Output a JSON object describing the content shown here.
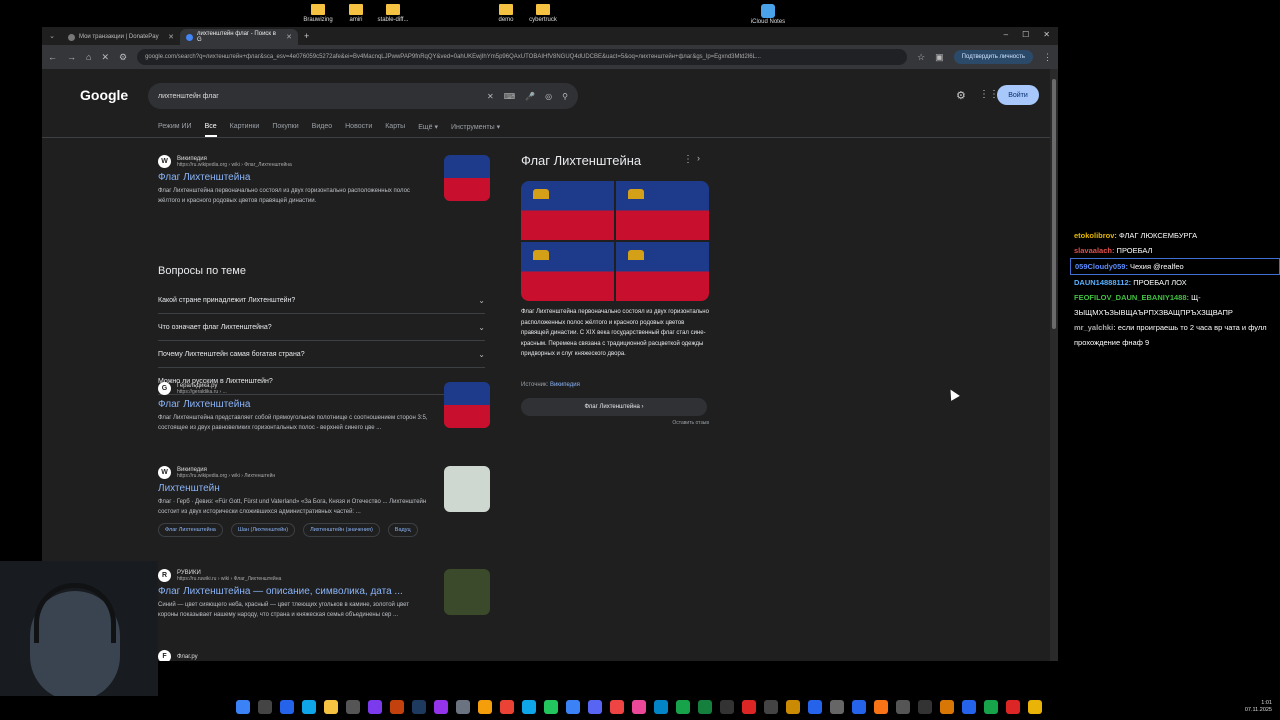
{
  "desktop": {
    "icons": [
      {
        "label": "Brauwizing"
      },
      {
        "label": "amiri"
      },
      {
        "label": "stable-diff..."
      },
      {
        "label": "demo"
      },
      {
        "label": "cybertruck"
      },
      {
        "label": "iCloud Notes"
      }
    ]
  },
  "browser": {
    "tabs": [
      {
        "label": "Мои транзакции | DonatePay"
      },
      {
        "label": "лихтенштейн флаг - Поиск в G"
      }
    ],
    "new_tab": "+",
    "url": "google.com/search?q=лихтенштейн+флаг&sca_esv=4e076059c5272afe&ei=Bv4MacnqLJPwwPAP9fnRqQY&ved=0ahUKEwjIhYm5p96QAxUTOBAIHfV8NGUQ4dUDCBE&uact=5&oq=лихтенштейн+флаг&gs_lp=Egxnd3Mtd2l6L...",
    "verify_label": "Подтвердить личность"
  },
  "google": {
    "logo": "Google",
    "query": "лихтенштейн флаг",
    "login_label": "Войти",
    "filters": [
      "Режим ИИ",
      "Все",
      "Картинки",
      "Покупки",
      "Видео",
      "Новости",
      "Карты",
      "Ещё",
      "Инструменты"
    ],
    "active_filter": "Все"
  },
  "results": [
    {
      "site": "Википедия",
      "url": "https://ru.wikipedia.org › wiki › Флаг_Лихтенштейна",
      "title": "Флаг Лихтенштейна",
      "snippet": "Флаг Лихтенштейна первоначально состоял из двух горизонтально расположенных полос жёлтого и красного родовых цветов правящей династии."
    },
    {
      "site": "Геральдика.ру",
      "url": "https://geraldika.ru › ...",
      "title": "Флаг Лихтенштейна",
      "snippet": "Флаг Лихтенштейна представляет собой прямоугольное полотнище с соотношением сторон 3:5, состоящее из двух равновеликих горизонтальных полос - верхней синего цве ..."
    },
    {
      "site": "Википедия",
      "url": "https://ru.wikipedia.org › wiki › Лихтенштейн",
      "title": "Лихтенштейн",
      "snippet": "Флаг · Герб · Девиз: «Für Gott, Fürst und Vaterland» «За Бога, Князя и Отечество ... Лихтенштейн состоит из двух исторически сложившихся административных частей: ...",
      "chips": [
        "Флаг Лихтенштейна",
        "Шан (Лихтенштейн)",
        "Лихтенштейн (значения)",
        "Вадуц"
      ]
    },
    {
      "site": "РУВИКИ",
      "url": "https://ru.ruwiki.ru › wiki › Флаг_Лихтенштейна",
      "title": "Флаг Лихтенштейна — описание, символика, дата ...",
      "snippet": "Синий — цвет сияющего неба, красный — цвет тлеющих угольков в камине, золотой цвет короны показывает нашему народу, что страна и княжеская семья объединены сер ..."
    },
    {
      "site": "Флаг.ру"
    }
  ],
  "paa": {
    "title": "Вопросы по теме",
    "items": [
      "Какой стране принадлежит Лихтенштейн?",
      "Что означает флаг Лихтенштейна?",
      "Почему Лихтенштейн самая богатая страна?",
      "Можно ли русским в Лихтенштейн?"
    ],
    "feedback": "Оставить отзыв"
  },
  "knowledge_panel": {
    "title": "Флаг Лихтенштейна",
    "description": "Флаг Лихтенштейна первоначально состоял из двух горизонтально расположенных полос жёлтого и красного родовых цветов правящей династии. С XIX века государственный флаг стал сине-красным. Перемена связана с традиционной расцветкой одежды придворных и слуг княжеского двора.",
    "source_label": "Источник:",
    "source_link": "Википедия",
    "button_label": "Флаг Лихтенштейна",
    "feedback": "Оставить отзыв"
  },
  "chat": [
    {
      "user": "etokolibrov:",
      "text": "ФЛАГ ЛЮКСЕМБУРГА",
      "color": "#e6b800"
    },
    {
      "user": "slavaalach:",
      "text": "ПРОЕБАЛ",
      "color": "#e05050"
    },
    {
      "user": "059Cloudy059:",
      "text": "Чехия @realfeo",
      "color": "#5b8cff"
    },
    {
      "user": "DAUN14888112:",
      "text": "ПРОЕБАЛ ЛОХ",
      "color": "#5ab0ff"
    },
    {
      "user": "FEOFILOV_DAUN_EBANIY1488:",
      "text": "Щ-ЗЫЩМХЪЗЫВЩАЪРПХЗВАЩПРЪХЗЩВАПР",
      "color": "#40c040"
    },
    {
      "user": "mr_yalchki:",
      "text": "если проиграешь то 2 часа вр чата и фулл прохождение фнаф 9",
      "color": "#aaaaaa"
    }
  ],
  "tray": {
    "time": "1:01",
    "date": "07.11.2025"
  }
}
